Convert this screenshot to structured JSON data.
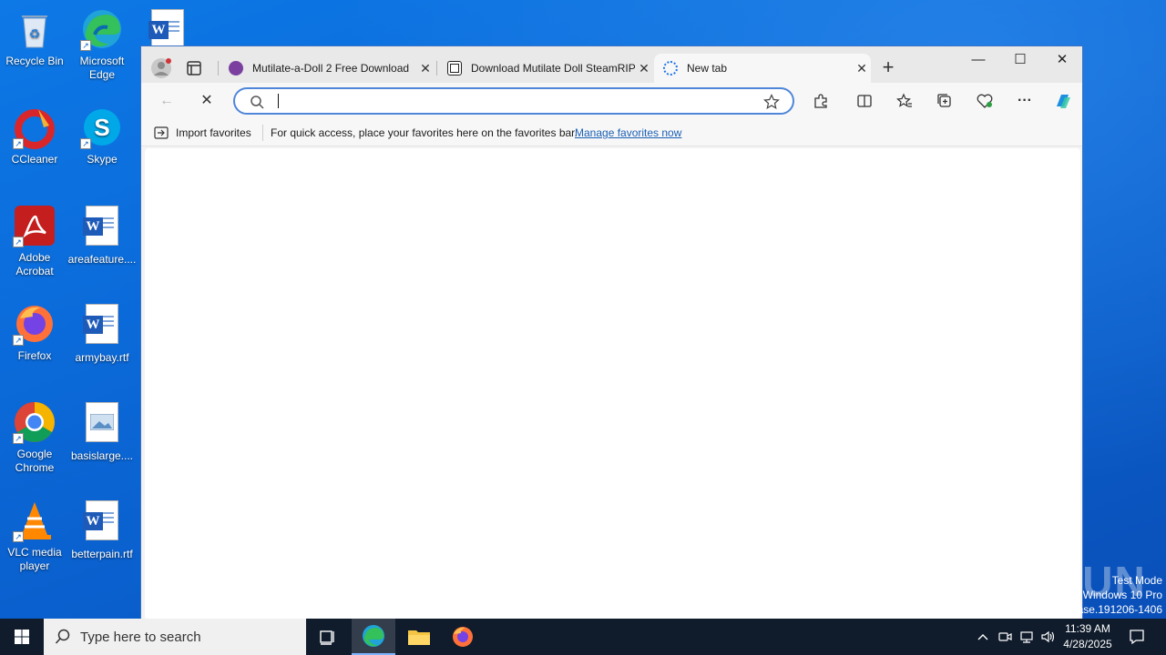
{
  "desktop": {
    "icons": [
      {
        "label": "Recycle Bin",
        "icon": "recycle-bin-icon"
      },
      {
        "label": "Microsoft Edge",
        "icon": "edge-icon"
      },
      {
        "label": "CCleaner",
        "icon": "ccleaner-icon"
      },
      {
        "label": "Skype",
        "icon": "skype-icon"
      },
      {
        "label": "Adobe Acrobat",
        "icon": "acrobat-icon"
      },
      {
        "label": "areafeature....",
        "icon": "word-document-icon"
      },
      {
        "label": "Firefox",
        "icon": "firefox-icon"
      },
      {
        "label": "armybay.rtf",
        "icon": "word-document-icon"
      },
      {
        "label": "Google Chrome",
        "icon": "chrome-icon"
      },
      {
        "label": "basislarge....",
        "icon": "image-file-icon"
      },
      {
        "label": "VLC media player",
        "icon": "vlc-icon"
      },
      {
        "label": "betterpain.rtf",
        "icon": "word-document-icon"
      }
    ]
  },
  "browser": {
    "tabs": [
      {
        "title": "Mutilate-a-Doll 2 Free Download",
        "active": false,
        "favicon_color": "#7b3fa0"
      },
      {
        "title": "Download Mutilate Doll SteamRIP",
        "active": false,
        "favicon_color": "#222222"
      },
      {
        "title": "New tab",
        "active": true,
        "favicon_color": "#1a73e8"
      }
    ],
    "new_tab_glyph": "+",
    "address": {
      "value": "",
      "placeholder": ""
    },
    "favorites_bar": {
      "import_label": "Import favorites",
      "hint": "For quick access, place your favorites here on the favorites bar.",
      "manage_link": "Manage favorites now"
    }
  },
  "overlay": {
    "watermark": "ANY RUN",
    "test_mode_lines": [
      "Test Mode",
      "Windows 10 Pro",
      "ase.191206-1406"
    ]
  },
  "taskbar": {
    "search_placeholder": "Type here to search",
    "time": "11:39 AM",
    "date": "4/28/2025"
  },
  "colors": {
    "accent": "#4f86d9",
    "link": "#1a5fb4",
    "taskbar": "#101c2c"
  }
}
